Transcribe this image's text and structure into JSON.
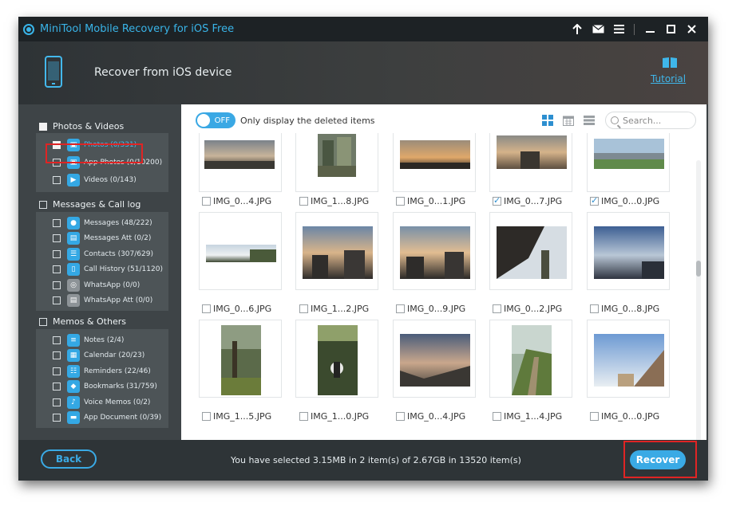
{
  "app": {
    "title": "MiniTool Mobile Recovery for iOS Free",
    "accent": "#39b4e8"
  },
  "titlebar_icons": [
    "upload-icon",
    "mail-icon",
    "menu-icon",
    "minimize-icon",
    "maximize-icon",
    "close-icon"
  ],
  "header": {
    "title": "Recover from iOS device",
    "tutorial": "Tutorial"
  },
  "sidebar": {
    "sections": [
      {
        "label": "Photos & Videos",
        "items": [
          {
            "label": "Photos (0/331)",
            "icon": "photo-icon"
          },
          {
            "label": "App Photos (0/10200)",
            "icon": "app-photo-icon"
          },
          {
            "label": "Videos (0/143)",
            "icon": "video-icon"
          }
        ]
      },
      {
        "label": "Messages & Call log",
        "items": [
          {
            "label": "Messages (48/222)",
            "icon": "message-icon"
          },
          {
            "label": "Messages Att (0/2)",
            "icon": "message-attachment-icon"
          },
          {
            "label": "Contacts (307/629)",
            "icon": "contacts-icon"
          },
          {
            "label": "Call History (51/1120)",
            "icon": "call-history-icon"
          },
          {
            "label": "WhatsApp (0/0)",
            "icon": "whatsapp-icon"
          },
          {
            "label": "WhatsApp Att (0/0)",
            "icon": "whatsapp-attachment-icon"
          }
        ]
      },
      {
        "label": "Memos & Others",
        "items": [
          {
            "label": "Notes (2/4)",
            "icon": "notes-icon"
          },
          {
            "label": "Calendar (20/23)",
            "icon": "calendar-icon"
          },
          {
            "label": "Reminders (22/46)",
            "icon": "reminders-icon"
          },
          {
            "label": "Bookmarks (31/759)",
            "icon": "bookmarks-icon"
          },
          {
            "label": "Voice Memos (0/2)",
            "icon": "voice-memos-icon"
          },
          {
            "label": "App Document (0/39)",
            "icon": "app-document-icon"
          }
        ]
      }
    ]
  },
  "toolbar": {
    "toggle_state": "OFF",
    "toggle_label": "Only display the deleted items",
    "search_placeholder": "Search..."
  },
  "files": [
    [
      {
        "name": "IMG_0...4.JPG",
        "checked": false
      },
      {
        "name": "IMG_1...8.JPG",
        "checked": false
      },
      {
        "name": "IMG_0...1.JPG",
        "checked": false
      },
      {
        "name": "IMG_0...7.JPG",
        "checked": true
      },
      {
        "name": "IMG_0...0.JPG",
        "checked": true
      }
    ],
    [
      {
        "name": "IMG_0...6.JPG",
        "checked": false
      },
      {
        "name": "IMG_1...2.JPG",
        "checked": false
      },
      {
        "name": "IMG_0...9.JPG",
        "checked": false
      },
      {
        "name": "IMG_0...2.JPG",
        "checked": false
      },
      {
        "name": "IMG_0...8.JPG",
        "checked": false
      }
    ],
    [
      {
        "name": "IMG_1...5.JPG",
        "checked": false
      },
      {
        "name": "IMG_1...0.JPG",
        "checked": false
      },
      {
        "name": "IMG_0...4.JPG",
        "checked": false
      },
      {
        "name": "IMG_1...4.JPG",
        "checked": false
      },
      {
        "name": "IMG_0...0.JPG",
        "checked": false
      }
    ]
  ],
  "footer": {
    "back": "Back",
    "status": "You have selected 3.15MB in 2 item(s) of 2.67GB in 13520 item(s)",
    "recover": "Recover"
  }
}
